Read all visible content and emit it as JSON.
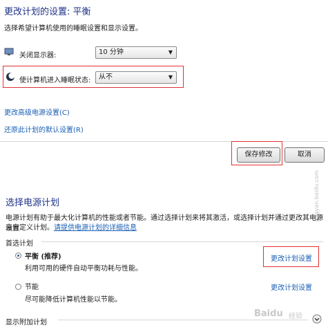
{
  "header": {
    "title": "更改计划的设置: 平衡",
    "subtitle": "选择希望计算机使用的睡眠设置和显示设置。"
  },
  "settings": {
    "display_off_label": "关闭显示器:",
    "display_off_value": "10 分钟",
    "sleep_label": "使计算机进入睡眠状态:",
    "sleep_value": "从不"
  },
  "links": {
    "advanced": "更改高级电源设置(C)",
    "restore": "还原此计划的默认设置(R)"
  },
  "buttons": {
    "save": "保存修改",
    "cancel": "取消"
  },
  "plans": {
    "title": "选择电源计划",
    "desc_line1": "电源计划有助于最大化计算机的性能或者节能。通过选择计划来将其激活，或选择计划并通过更改其电源设置",
    "desc_line2_prefix": "来自定义计划。",
    "desc_link": "请提供电源计划的详细信息",
    "preferred_label": "首选计划",
    "items": [
      {
        "name": "平衡 (推荐)",
        "desc": "利用可用的硬件自动平衡功耗与性能。",
        "change": "更改计划设置",
        "selected": true
      },
      {
        "name": "节能",
        "desc": "尽可能降低计算机性能以节能。",
        "change": "更改计划设置",
        "selected": false
      }
    ],
    "show_more": "显示附加计划"
  },
  "watermark": {
    "side": "jingyan.baidu.com",
    "bottom_brand": "Baidu",
    "bottom_sub": "经验"
  }
}
